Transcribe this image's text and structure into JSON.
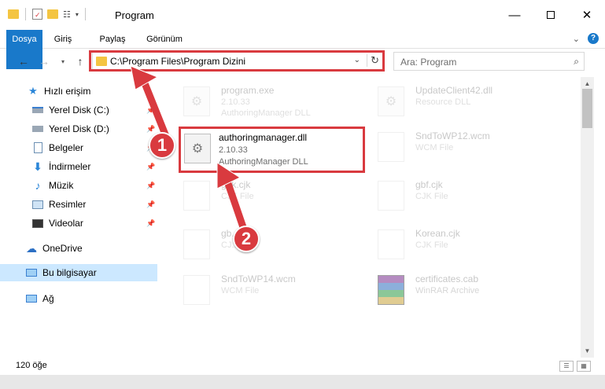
{
  "window": {
    "title": "Program"
  },
  "ribbon": {
    "tabs": [
      {
        "label": "Dosya"
      },
      {
        "label": "Giriş"
      },
      {
        "label": "Paylaş"
      },
      {
        "label": "Görünüm"
      }
    ],
    "help_label": "?"
  },
  "address_bar": {
    "path": "C:\\Program Files\\Program Dizini"
  },
  "search": {
    "placeholder": "Ara: Program"
  },
  "sidebar": {
    "items": [
      {
        "label": "Hızlı erişim",
        "icon": "star-icon"
      },
      {
        "label": "Yerel Disk (C:)",
        "icon": "drive-icon"
      },
      {
        "label": "Yerel Disk (D:)",
        "icon": "drive-icon"
      },
      {
        "label": "Belgeler",
        "icon": "documents-icon"
      },
      {
        "label": "İndirmeler",
        "icon": "download-icon"
      },
      {
        "label": "Müzik",
        "icon": "music-icon"
      },
      {
        "label": "Resimler",
        "icon": "pictures-icon"
      },
      {
        "label": "Videolar",
        "icon": "video-icon"
      },
      {
        "label": "OneDrive",
        "icon": "cloud-icon"
      },
      {
        "label": "Bu bilgisayar",
        "icon": "computer-icon"
      },
      {
        "label": "Ağ",
        "icon": "network-icon"
      }
    ]
  },
  "files": [
    {
      "name": "program.exe",
      "line1": "2.10.33",
      "line2": "AuthoringManager DLL"
    },
    {
      "name": "UpdateClient42.dll",
      "line1": "Resource DLL",
      "line2": ""
    },
    {
      "name": "authoringmanager.dll",
      "line1": "2.10.33",
      "line2": "AuthoringManager DLL"
    },
    {
      "name": "SndToWP12.wcm",
      "line1": "WCM File",
      "line2": ""
    },
    {
      "name": "gbk.cjk",
      "line1": "CJK File",
      "line2": ""
    },
    {
      "name": "gbf.cjk",
      "line1": "CJK File",
      "line2": ""
    },
    {
      "name": "gb...",
      "line1": "CJ...",
      "line2": ""
    },
    {
      "name": "Korean.cjk",
      "line1": "CJK File",
      "line2": ""
    },
    {
      "name": "SndToWP14.wcm",
      "line1": "WCM File",
      "line2": ""
    },
    {
      "name": "certificates.cab",
      "line1": "WinRAR Archive",
      "line2": ""
    }
  ],
  "status": {
    "item_count": "120 öğe"
  },
  "annotations": {
    "step1": "1",
    "step2": "2",
    "color": "#d93a3f"
  }
}
